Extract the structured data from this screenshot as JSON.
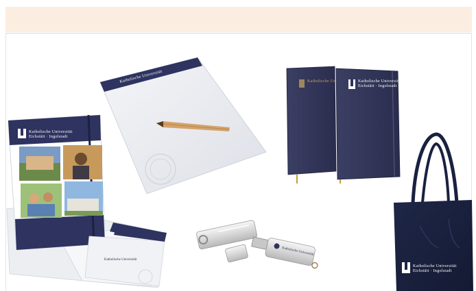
{
  "header_band": {
    "color": "#fbeee1"
  },
  "brand": {
    "line1": "Katholische Universität",
    "line2": "Eichstätt · Ingolstadt",
    "navy": "#2e3360",
    "gold": "#c4a46a"
  },
  "products": [
    {
      "name": "folder"
    },
    {
      "name": "notepad"
    },
    {
      "name": "pencil"
    },
    {
      "name": "notebooks"
    },
    {
      "name": "usb-stick"
    },
    {
      "name": "tote-bag"
    }
  ]
}
